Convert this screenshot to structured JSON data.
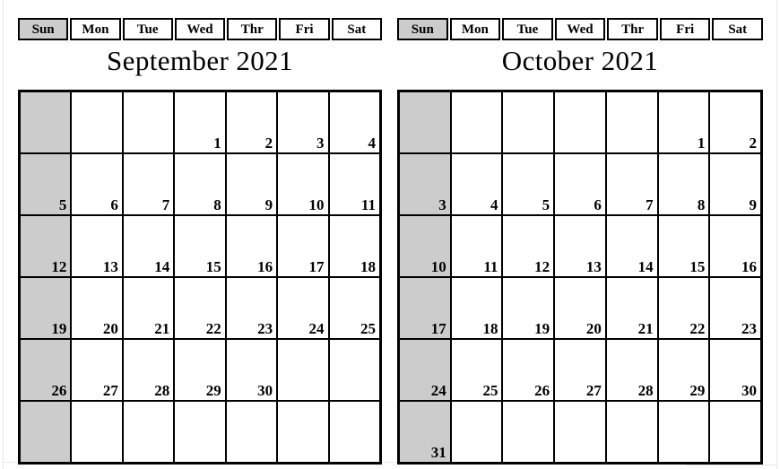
{
  "page": {
    "weekday_headers": [
      "Sun",
      "Mon",
      "Tue",
      "Wed",
      "Thr",
      "Fri",
      "Sat"
    ],
    "sunday_highlight_color": "#cccccc",
    "text_color": "#000000",
    "background_color": "#ffffff"
  },
  "calendars": [
    {
      "id": "september-2021",
      "title": "September 2021",
      "month": "September",
      "year": "2021",
      "first_day_of_week_index": 3,
      "days_in_month": 30,
      "weeks": [
        [
          "",
          "",
          "",
          "1",
          "2",
          "3",
          "4"
        ],
        [
          "5",
          "6",
          "7",
          "8",
          "9",
          "10",
          "11"
        ],
        [
          "12",
          "13",
          "14",
          "15",
          "16",
          "17",
          "18"
        ],
        [
          "19",
          "20",
          "21",
          "22",
          "23",
          "24",
          "25"
        ],
        [
          "26",
          "27",
          "28",
          "29",
          "30",
          "",
          ""
        ],
        [
          "",
          "",
          "",
          "",
          "",
          "",
          ""
        ]
      ]
    },
    {
      "id": "october-2021",
      "title": "October 2021",
      "month": "October",
      "year": "2021",
      "first_day_of_week_index": 5,
      "days_in_month": 31,
      "weeks": [
        [
          "",
          "",
          "",
          "",
          "",
          "1",
          "2"
        ],
        [
          "3",
          "4",
          "5",
          "6",
          "7",
          "8",
          "9"
        ],
        [
          "10",
          "11",
          "12",
          "13",
          "14",
          "15",
          "16"
        ],
        [
          "17",
          "18",
          "19",
          "20",
          "21",
          "22",
          "23"
        ],
        [
          "24",
          "25",
          "26",
          "27",
          "28",
          "29",
          "30"
        ],
        [
          "31",
          "",
          "",
          "",
          "",
          "",
          ""
        ]
      ]
    }
  ]
}
